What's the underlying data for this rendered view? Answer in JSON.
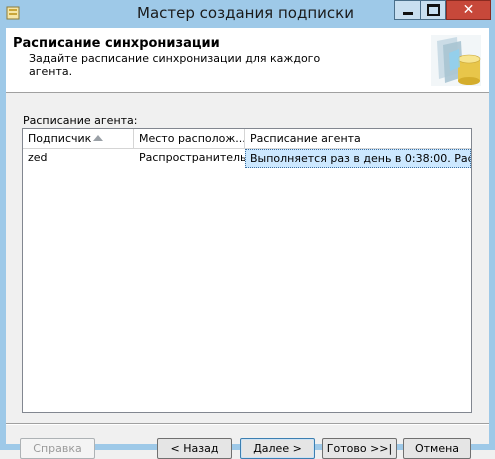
{
  "window": {
    "title": "Мастер создания подписки"
  },
  "header": {
    "title": "Расписание синхронизации",
    "subtitle": "Задайте расписание синхронизации для каждого агента."
  },
  "grid": {
    "label": "Расписание агента:",
    "columns": [
      "Подписчик",
      "Место располож...",
      "Расписание агента"
    ],
    "rows": [
      {
        "subscriber": "zed",
        "location": "Распространитель",
        "schedule": "Выполняется раз в день в 0:38:00. Рас..."
      }
    ]
  },
  "buttons": {
    "help": "Справка",
    "back": "< Назад",
    "next": "Далее >",
    "finish": "Готово >>|",
    "cancel": "Отмена"
  }
}
